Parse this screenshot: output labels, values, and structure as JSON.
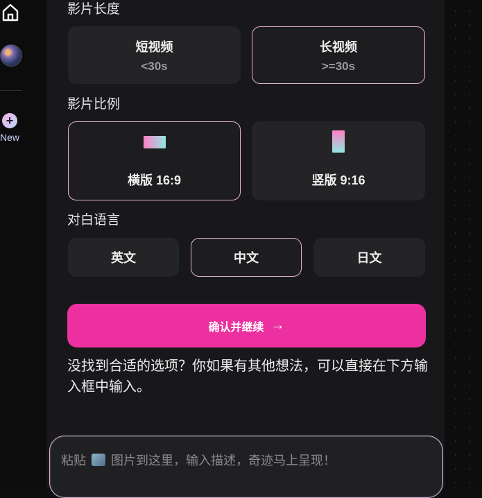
{
  "sidebar": {
    "new_label": "New",
    "new_symbol": "+"
  },
  "sections": {
    "length_label": "影片长度",
    "ratio_label": "影片比例",
    "language_label": "对白语言"
  },
  "length_options": [
    {
      "title": "短视频",
      "sub": "<30s",
      "selected": false
    },
    {
      "title": "长视频",
      "sub": ">=30s",
      "selected": true
    }
  ],
  "ratio_options": [
    {
      "title": "横版 16:9",
      "selected": true
    },
    {
      "title": "竖版 9:16",
      "selected": false
    }
  ],
  "language_options": [
    {
      "title": "英文",
      "selected": false
    },
    {
      "title": "中文",
      "selected": true
    },
    {
      "title": "日文",
      "selected": false
    }
  ],
  "confirm": {
    "label": "确认并继续",
    "arrow": "→"
  },
  "hint_text": "没找到合适的选项？你如果有其他想法，可以直接在下方输入框中输入。",
  "input": {
    "placeholder_pre": "粘贴",
    "placeholder_post": "图片到这里，输入描述，奇迹马上呈现！"
  },
  "colors": {
    "accent": "#ec30a0",
    "selected_border": "#e9b3d2",
    "card_bg": "#242427",
    "panel_bg": "#18181a"
  }
}
